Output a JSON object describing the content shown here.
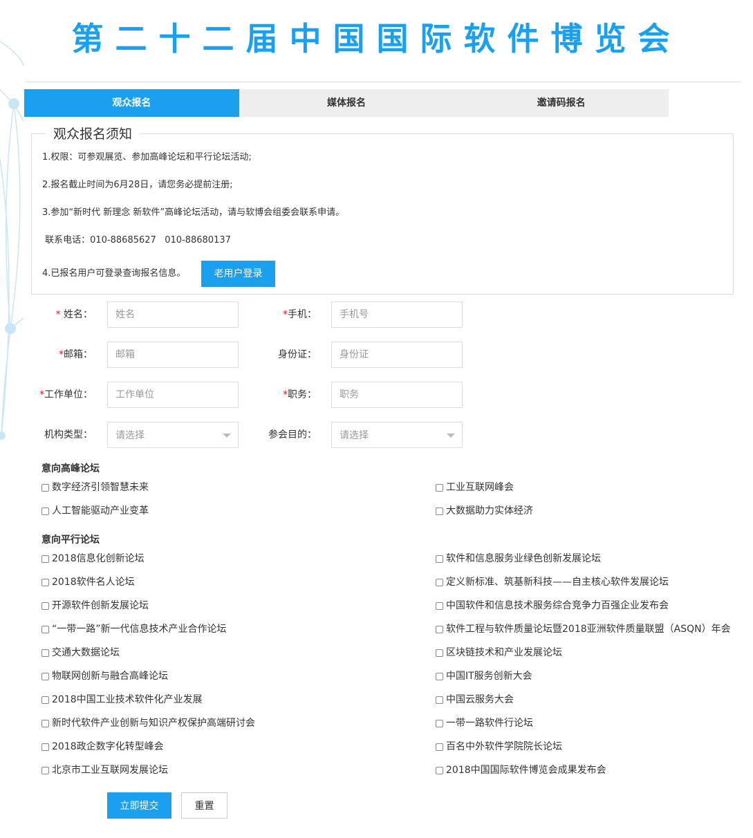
{
  "page_title": "第二十二届中国国际软件博览会",
  "colors": {
    "accent": "#1ba0f0",
    "required": "#e02020",
    "tab_bg": "#eeeeee"
  },
  "tabs": [
    {
      "label": "观众报名",
      "active": true
    },
    {
      "label": "媒体报名",
      "active": false
    },
    {
      "label": "邀请码报名",
      "active": false
    }
  ],
  "notice": {
    "heading": "观众报名须知",
    "lines": [
      "1.权限：可参观展览、参加高峰论坛和平行论坛活动;",
      "2.报名截止时间为6月28日，请您务必提前注册;",
      "3.参加“新时代 新理念 新软件”高峰论坛活动，请与软博会组委会联系申请。",
      " 联系电话：010-88685627   010-88680137",
      "4.已报名用户可登录查询报名信息。"
    ],
    "old_user_button": "老用户登录"
  },
  "form": {
    "name": {
      "label": "姓名：",
      "required": true,
      "placeholder": "姓名"
    },
    "phone": {
      "label": "手机：",
      "required": true,
      "placeholder": "手机号"
    },
    "email": {
      "label": "邮箱：",
      "required": true,
      "placeholder": "邮箱"
    },
    "id_card": {
      "label": "身份证：",
      "required": false,
      "placeholder": "身份证"
    },
    "company": {
      "label": "工作单位：",
      "required": true,
      "placeholder": "工作单位"
    },
    "position": {
      "label": "职务：",
      "required": true,
      "placeholder": "职务"
    },
    "org_type": {
      "label": "机构类型：",
      "selected": "请选择"
    },
    "purpose": {
      "label": "参会目的：",
      "selected": "请选择"
    },
    "required_mark": "*"
  },
  "summit_forums": {
    "heading": "意向高峰论坛",
    "left": [
      "数字经济引领智慧未来",
      "人工智能驱动产业变革"
    ],
    "right": [
      "工业互联网峰会",
      "大数据助力实体经济"
    ]
  },
  "parallel_forums": {
    "heading": "意向平行论坛",
    "left": [
      "2018信息化创新论坛",
      "2018软件名人论坛",
      "开源软件创新发展论坛",
      "“一带一路”新一代信息技术产业合作论坛",
      "交通大数据论坛",
      "物联网创新与融合高峰论坛",
      "2018中国工业技术软件化产业发展",
      "新时代软件产业创新与知识产权保护高端研讨会",
      "2018政企数字化转型峰会",
      "北京市工业互联网发展论坛"
    ],
    "right": [
      "软件和信息服务业绿色创新发展论坛",
      "定义新标准、筑基新科技——自主核心软件发展论坛",
      "中国软件和信息技术服务综合竞争力百强企业发布会",
      "软件工程与软件质量论坛暨2018亚洲软件质量联盟（ASQN）年会",
      "区块链技术和产业发展论坛",
      "中国IT服务创新大会",
      "中国云服务大会",
      "一带一路软件行论坛",
      "百名中外软件学院院长论坛",
      "2018中国国际软件博览会成果发布会"
    ]
  },
  "buttons": {
    "submit": "立即提交",
    "reset": "重置"
  }
}
